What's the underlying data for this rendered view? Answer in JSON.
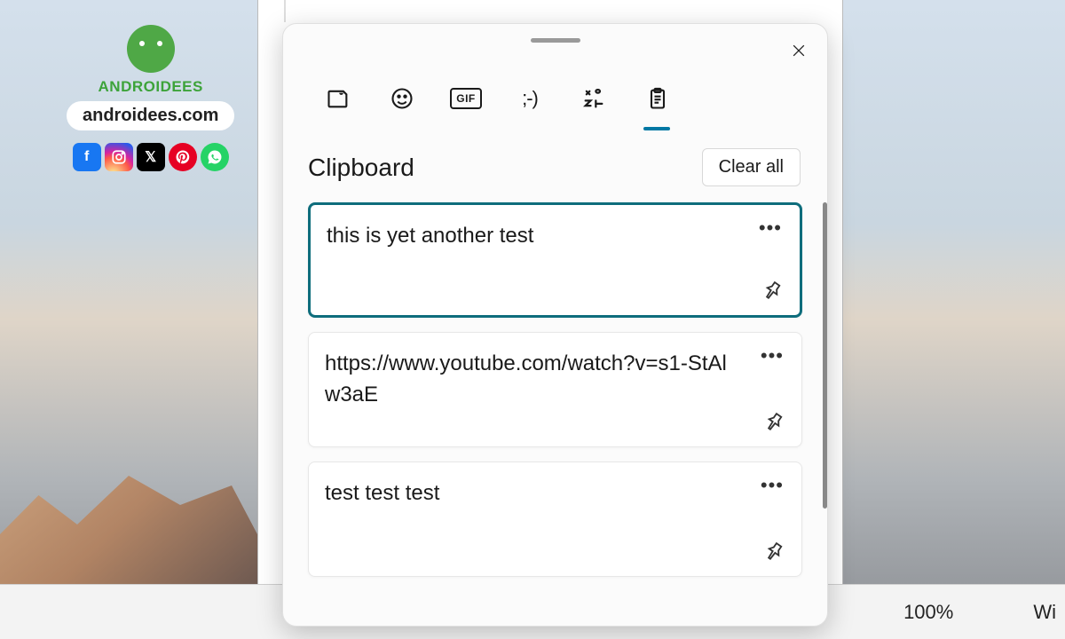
{
  "watermark": {
    "brand": "ANDROIDEES",
    "url": "androidees.com"
  },
  "panel": {
    "section_title": "Clipboard",
    "clear_label": "Clear all",
    "items": [
      {
        "text": "this is yet another test",
        "selected": true
      },
      {
        "text": "https://www.youtube.com/watch?v=s1-StAlw3aE",
        "selected": false
      },
      {
        "text": "test test test",
        "selected": false
      }
    ]
  },
  "tabs": {
    "gif_label": "GIF",
    "kaomoji_label": ";-)"
  },
  "statusbar": {
    "zoom": "100%",
    "wordcount_prefix": "Wi"
  }
}
